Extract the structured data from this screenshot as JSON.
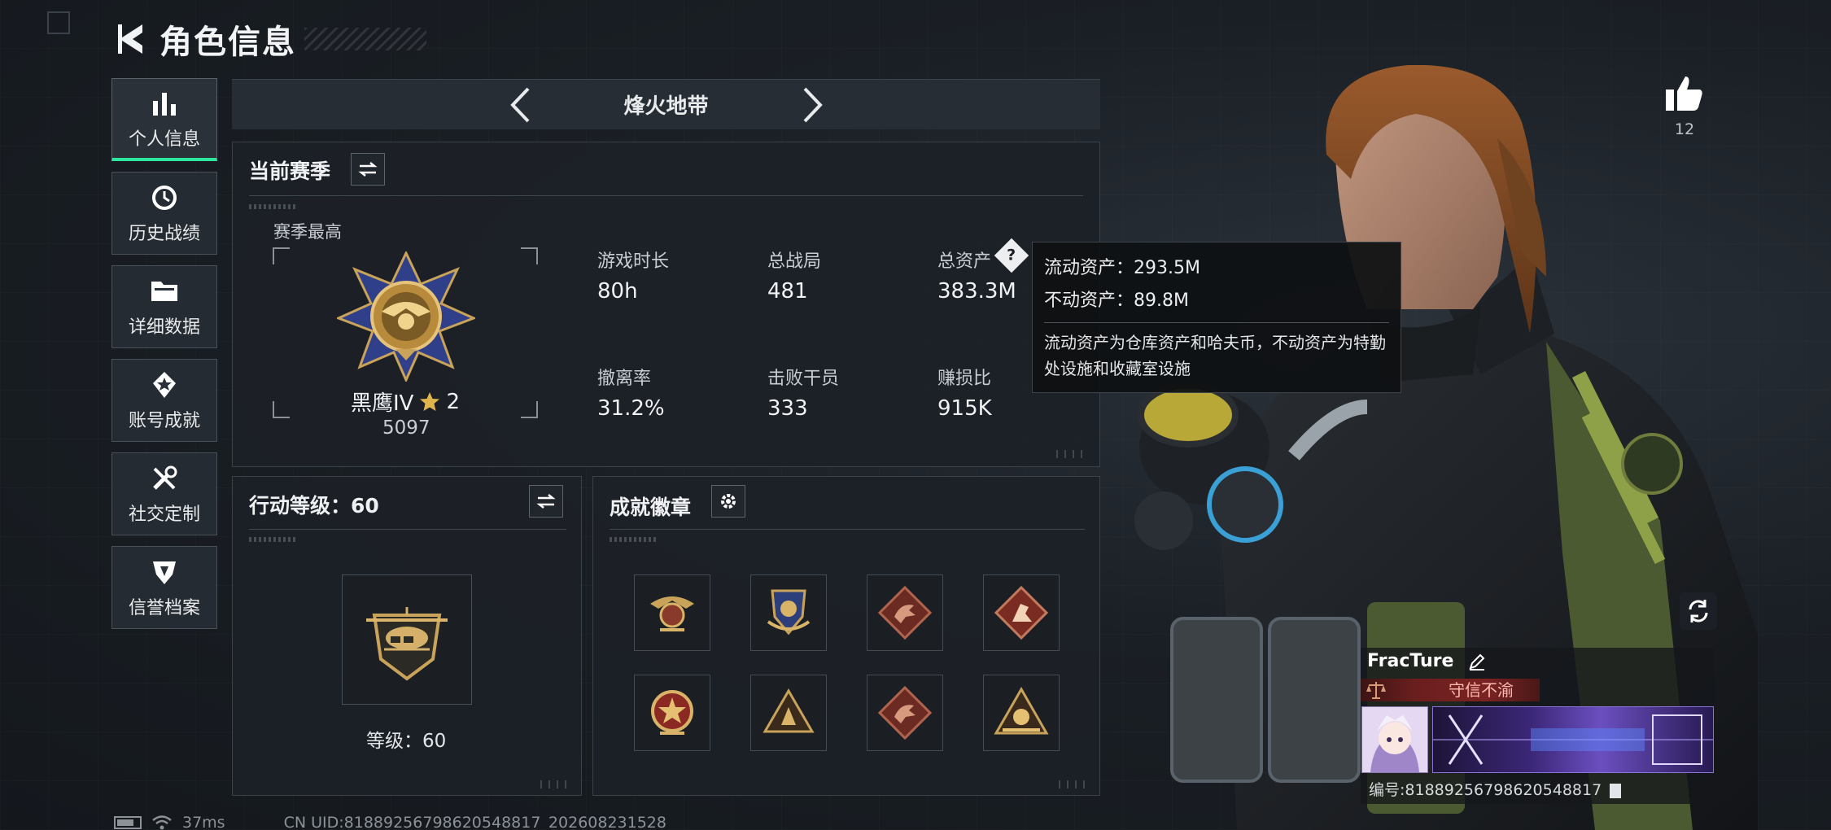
{
  "header": {
    "title": "角色信息"
  },
  "sidebar": {
    "items": [
      {
        "label": "个人信息",
        "icon": "bar-chart-icon"
      },
      {
        "label": "历史战绩",
        "icon": "history-icon"
      },
      {
        "label": "详细数据",
        "icon": "folder-icon"
      },
      {
        "label": "账号成就",
        "icon": "achievement-icon"
      },
      {
        "label": "社交定制",
        "icon": "tools-icon"
      },
      {
        "label": "信誉档案",
        "icon": "shield-badge-icon"
      }
    ]
  },
  "mode_tab": {
    "label": "烽火地带"
  },
  "season_panel": {
    "title": "当前赛季",
    "rank_caption": "赛季最高",
    "rank_name": "黑鹰IV",
    "rank_stars": "2",
    "rank_points": "5097",
    "stats": [
      {
        "label": "游戏时长",
        "value": "80h"
      },
      {
        "label": "总战局",
        "value": "481"
      },
      {
        "label": "总资产",
        "value": "383.3M"
      },
      {
        "label": "撤离率",
        "value": "31.2%"
      },
      {
        "label": "击败干员",
        "value": "333"
      },
      {
        "label": "赚损比",
        "value": "915K"
      }
    ]
  },
  "tooltip": {
    "liquid": "流动资产：293.5M",
    "fixed": "不动资产：89.8M",
    "desc": "流动资产为仓库资产和哈夫币，不动资产为特勤处设施和收藏室设施"
  },
  "level_panel": {
    "title": "行动等级：60",
    "level_text": "等级：60"
  },
  "badge_panel": {
    "title": "成就徽章"
  },
  "likes": {
    "count": "12"
  },
  "player": {
    "name": "FracTure",
    "title": "守信不渝",
    "uid_line": "编号:8188925679862054881​7"
  },
  "status": {
    "ping": "37ms",
    "uid": "CN UID:8188925679862054881​7_202608231528"
  },
  "colors": {
    "accent": "#2ee59d",
    "gold": "#c9a35a",
    "title_red": "#7a2323"
  }
}
